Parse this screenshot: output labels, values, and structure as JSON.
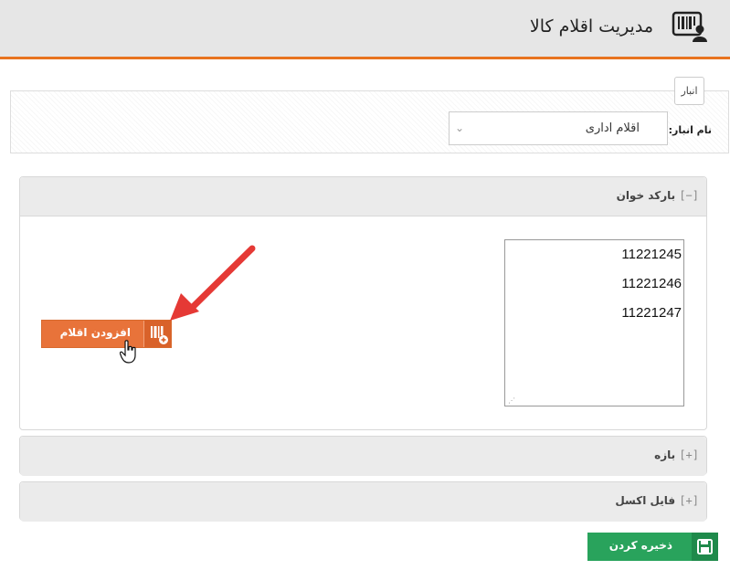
{
  "header": {
    "title": "مدیریت اقلام کالا",
    "icon": "barcode-user-icon",
    "accent_color": "#e8731f"
  },
  "warehouse": {
    "legend": "انبار",
    "name_label": "نام انبار:",
    "selected_value": "اقلام اداری"
  },
  "barcode_panel": {
    "toggle": "[−]",
    "title": "بارکد خوان",
    "codes": [
      "11221245",
      "11221246",
      "11221247"
    ],
    "add_button_label": "افزودن اقلام"
  },
  "range_panel": {
    "toggle": "[+]",
    "title": "بازه"
  },
  "excel_panel": {
    "toggle": "[+]",
    "title": "فایل اکسل"
  },
  "save_button": {
    "label": "ذخیره کردن",
    "color": "#29a35c"
  }
}
